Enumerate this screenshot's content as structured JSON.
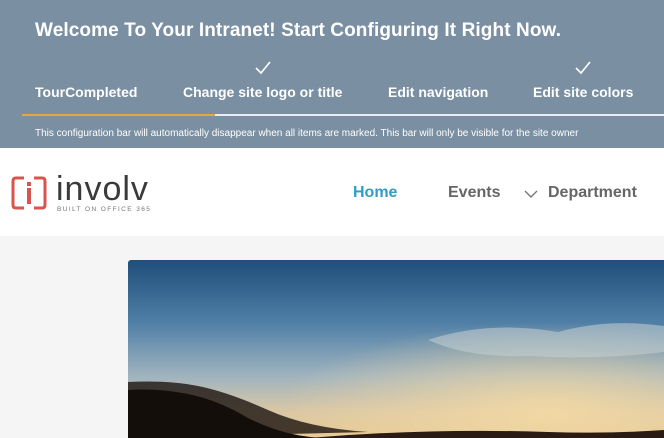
{
  "config_bar": {
    "title": "Welcome To Your Intranet! Start Configuring It Right Now.",
    "steps": [
      {
        "label": "TourCompleted",
        "checked": false
      },
      {
        "label": "Change site logo or title",
        "checked": true
      },
      {
        "label": "Edit navigation",
        "checked": false
      },
      {
        "label": "Edit site colors",
        "checked": true
      }
    ],
    "progress": 0.3,
    "note": "This configuration bar will automatically disappear when all items are marked. This bar will only be visible for the site owner",
    "colors": {
      "background": "#7a8fa2",
      "progress": "#e0a847"
    }
  },
  "header": {
    "logo_text": "involv",
    "logo_tagline": "BUILT ON OFFICE 365",
    "nav": [
      {
        "label": "Home",
        "active": true
      },
      {
        "label": "Events",
        "active": false
      },
      {
        "label": "Department",
        "active": false,
        "has_dropdown": true
      }
    ],
    "colors": {
      "accent": "#2e9fc4",
      "logo": "#d9544f"
    }
  },
  "hero": {
    "image": "sunset-dunes-landscape"
  }
}
